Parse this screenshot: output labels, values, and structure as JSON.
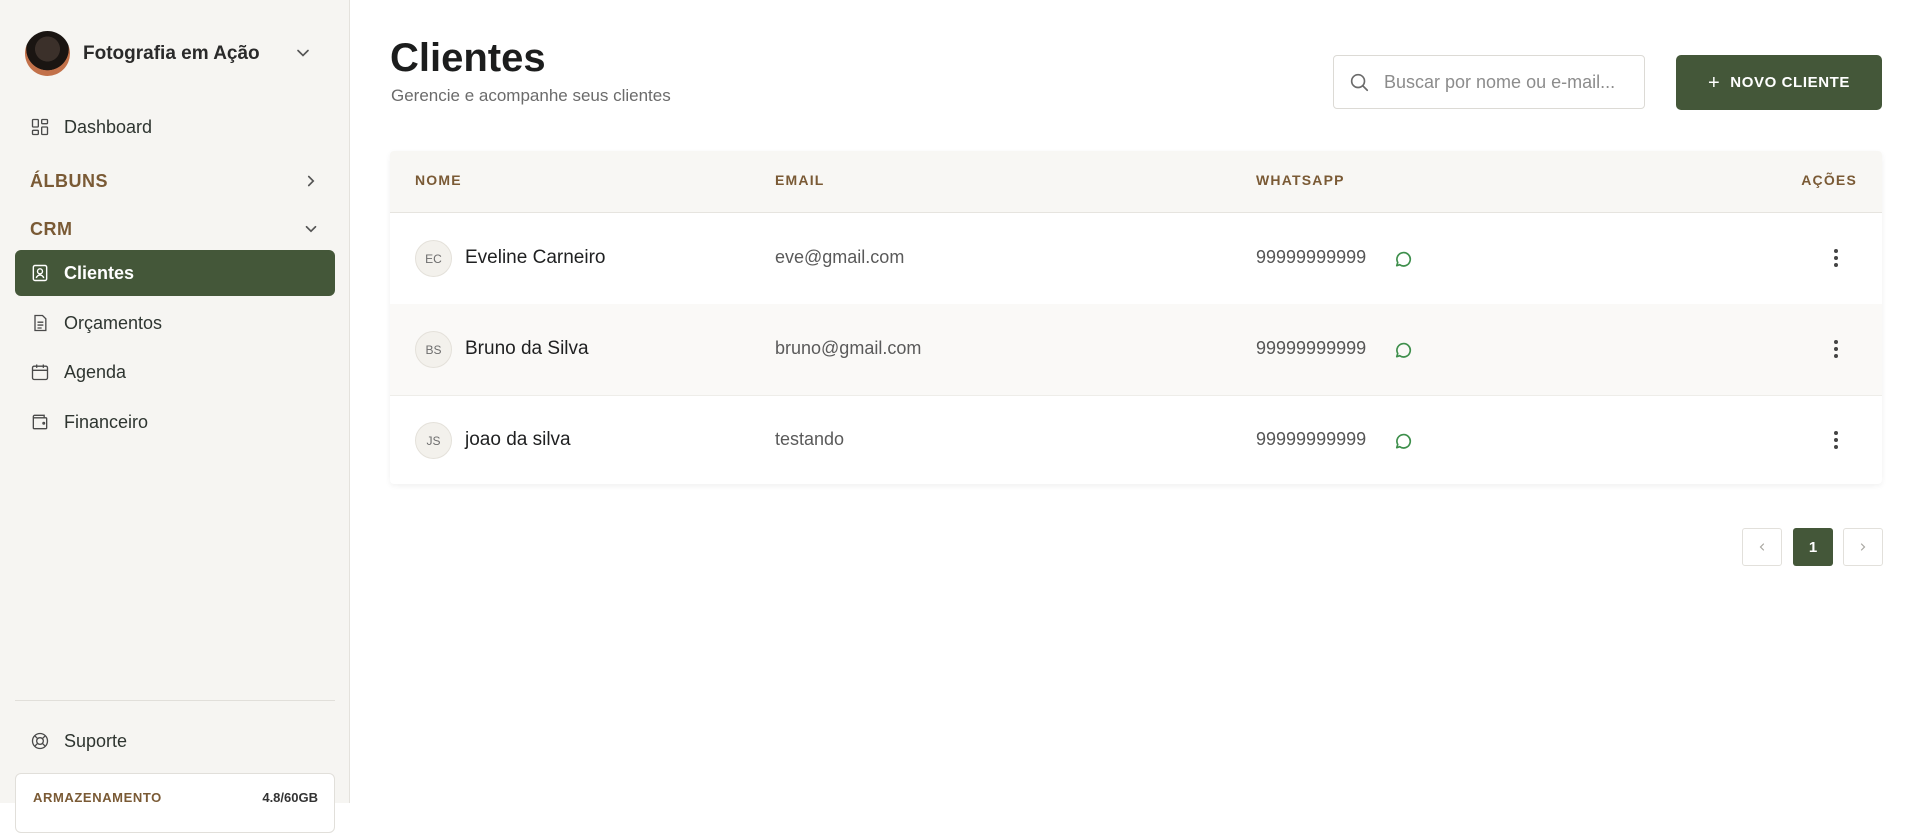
{
  "workspace": {
    "name": "Fotografia em Ação"
  },
  "sidebar": {
    "dashboard": "Dashboard",
    "albums_section": "ÁLBUNS",
    "crm_section": "CRM",
    "crm_items": [
      {
        "label": "Clientes",
        "active": true
      },
      {
        "label": "Orçamentos"
      },
      {
        "label": "Agenda"
      },
      {
        "label": "Financeiro"
      }
    ],
    "support": "Suporte",
    "storage": {
      "label": "ARMAZENAMENTO",
      "value": "4.8/60GB"
    }
  },
  "page": {
    "title": "Clientes",
    "subtitle": "Gerencie e acompanhe seus clientes",
    "search_placeholder": "Buscar por nome ou e-mail...",
    "new_button": "NOVO CLIENTE"
  },
  "table": {
    "columns": [
      "NOME",
      "EMAIL",
      "WHATSAPP",
      "AÇÕES"
    ],
    "rows": [
      {
        "initials": "EC",
        "name": "Eveline Carneiro",
        "email": "eve@gmail.com",
        "whatsapp": "99999999999"
      },
      {
        "initials": "BS",
        "name": "Bruno da Silva",
        "email": "bruno@gmail.com",
        "whatsapp": "99999999999"
      },
      {
        "initials": "JS",
        "name": "joao da silva",
        "email": "testando",
        "whatsapp": "99999999999"
      }
    ]
  },
  "pagination": {
    "current": "1"
  },
  "colors": {
    "accent": "#445739",
    "section": "#7a5a35",
    "whatsapp": "#3e8f4c"
  }
}
